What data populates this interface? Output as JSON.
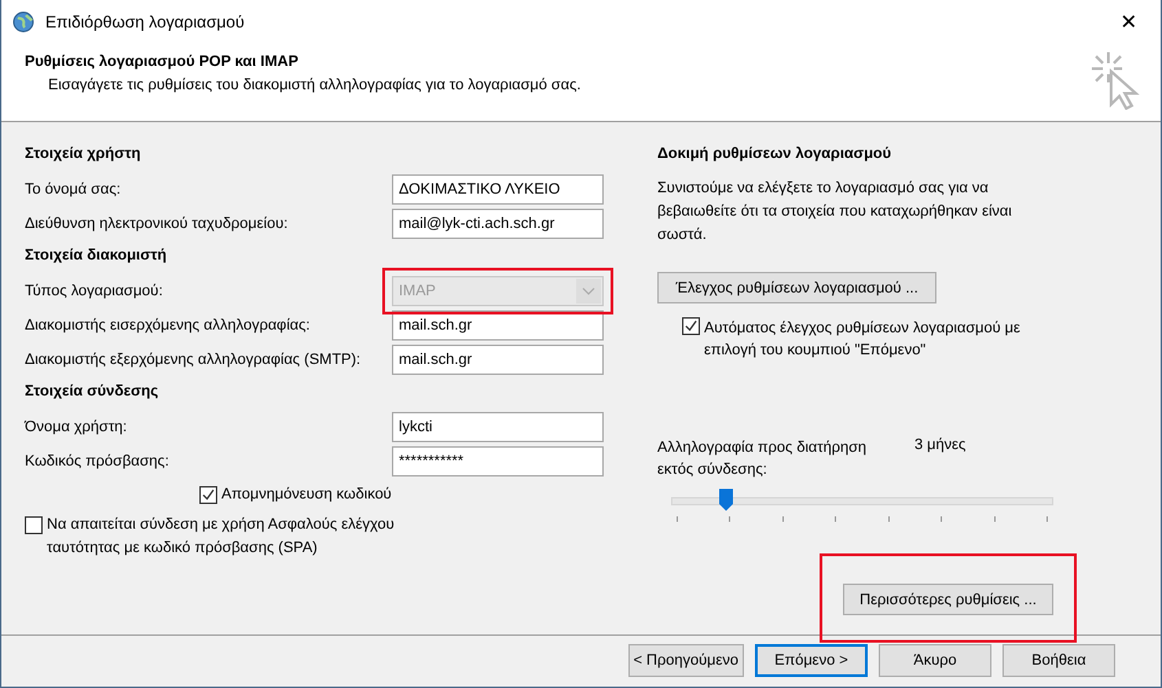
{
  "window": {
    "title": "Επιδιόρθωση λογαριασμού",
    "close": "✕"
  },
  "header": {
    "title": "Ρυθμίσεις λογαριασμού POP και IMAP",
    "subtitle": "Εισαγάγετε τις ρυθμίσεις του διακομιστή αλληλογραφίας για το λογαριασμό σας."
  },
  "left": [
    {
      "kind": "section",
      "label": "Στοιχεία χρήστη"
    },
    {
      "kind": "field",
      "label": "Το όνομά σας:",
      "value": "ΔΟΚΙΜΑΣΤΙΚΟ ΛΥΚΕΙΟ"
    },
    {
      "kind": "field",
      "label": "Διεύθυνση ηλεκτρονικού ταχυδρομείου:",
      "value": "mail@lyk-cti.ach.sch.gr"
    },
    {
      "kind": "section",
      "label": "Στοιχεία διακομιστή"
    },
    {
      "kind": "combo",
      "label": "Τύπος λογαριασμού:",
      "value": "IMAP",
      "disabled": true,
      "highlighted": true
    },
    {
      "kind": "field",
      "label": "Διακομιστής εισερχόμενης αλληλογραφίας:",
      "value": "mail.sch.gr"
    },
    {
      "kind": "field",
      "label": "Διακομιστής εξερχόμενης αλληλογραφίας (SMTP):",
      "value": "mail.sch.gr"
    },
    {
      "kind": "section",
      "label": "Στοιχεία σύνδεσης"
    },
    {
      "kind": "field",
      "label": "Όνομα χρήστη:",
      "value": "lykcti"
    },
    {
      "kind": "field",
      "label": "Κωδικός πρόσβασης:",
      "value": "***********"
    },
    {
      "kind": "check",
      "label": "Απομνημόνευση κωδικού",
      "checked": true
    }
  ],
  "spa": {
    "label": "Να απαιτείται σύνδεση με χρήση Ασφαλούς ελέγχου ταυτότητας με κωδικό πρόσβασης (SPA)",
    "checked": false
  },
  "test": {
    "title": "Δοκιμή ρυθμίσεων λογαριασμού",
    "text": "Συνιστούμε να ελέγξετε το λογαριασμό σας για να βεβαιωθείτε ότι τα στοιχεία που καταχωρήθηκαν είναι σωστά.",
    "button": "Έλεγχος ρυθμίσεων λογαριασμού ...",
    "auto": {
      "label": "Αυτόματος έλεγχος ρυθμίσεων λογαριασμού με επιλογή του κουμπιού \"Επόμενο\"",
      "checked": true
    }
  },
  "offline": {
    "label": "Αλληλογραφία προς διατήρηση εκτός σύνδεσης:",
    "reading": "3 μήνες",
    "level": 0.143
  },
  "more": {
    "label": "Περισσότερες ρυθμίσεις ...",
    "highlighted": true
  },
  "buttons": [
    {
      "label": "< Προηγούμενο",
      "default": false
    },
    {
      "label": "Επόμενο >",
      "default": true
    },
    {
      "label": "Άκυρο",
      "default": false
    },
    {
      "label": "Βοήθεια",
      "default": false
    }
  ]
}
